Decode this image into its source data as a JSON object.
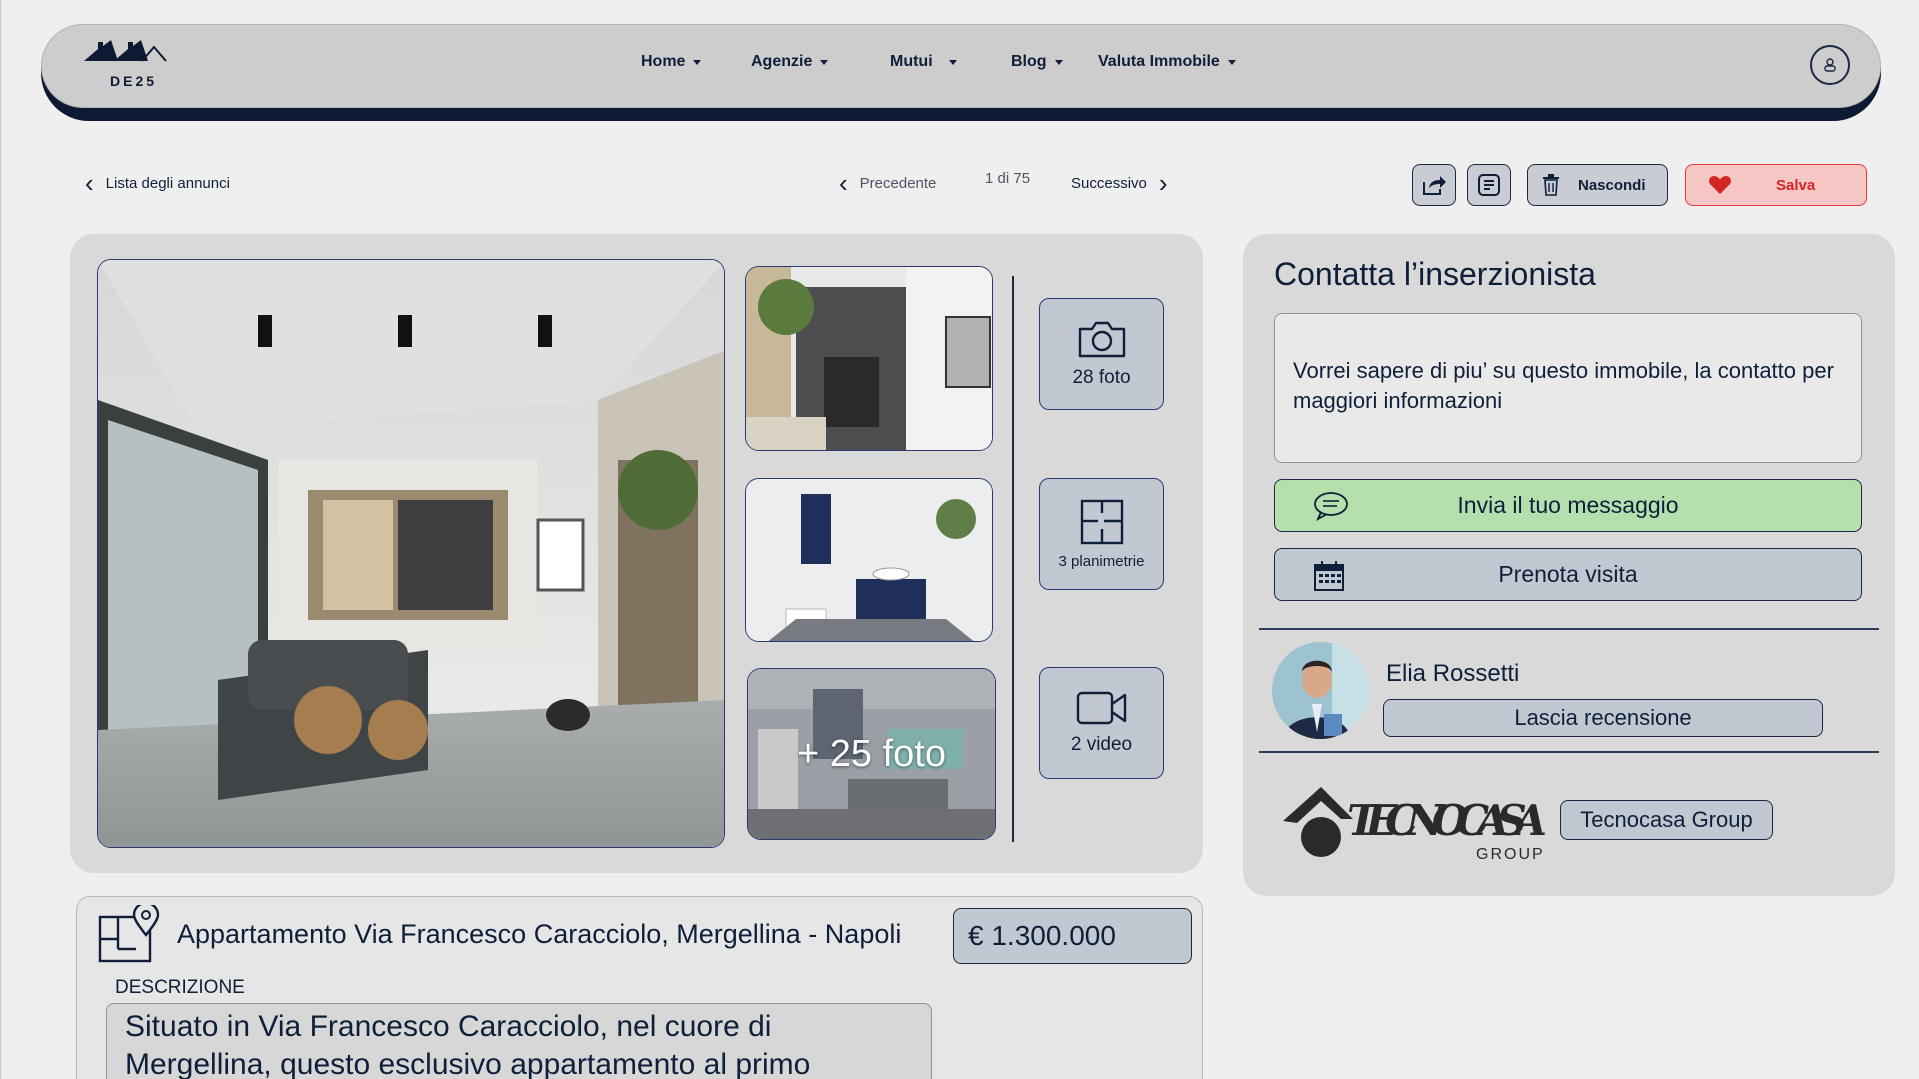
{
  "brand": {
    "name": "DE25"
  },
  "nav": {
    "items": [
      {
        "label": "Home"
      },
      {
        "label": "Agenzie"
      },
      {
        "label": "Mutui"
      },
      {
        "label": "Blog"
      },
      {
        "label": "Valuta Immobile"
      }
    ]
  },
  "subbar": {
    "back_label": "Lista degli annunci",
    "prev_label": "Precedente",
    "pagination": "1 di 75",
    "next_label": "Successivo",
    "hide_label": "Nascondi",
    "save_label": "Salva"
  },
  "gallery": {
    "more_photos": "+ 25 foto",
    "photos_label": "28 foto",
    "plans_label": "3 planimetrie",
    "video_label": "2 video"
  },
  "contact": {
    "title": "Contatta l’inserzionista",
    "message": "Vorrei sapere di piu’ su questo immobile, la contatto per maggiori informazioni",
    "send_label": "Invia il tuo messaggio",
    "visit_label": "Prenota visita",
    "agent_name": "Elia Rossetti",
    "review_label": "Lascia recensione",
    "agency_logo_text": "TECNOCASA",
    "agency_logo_sub": "GROUP",
    "agency_label": "Tecnocasa Group"
  },
  "listing": {
    "title": "Appartamento Via Francesco Caracciolo, Mergellina - Napoli",
    "price": "€ 1.300.000",
    "description_label": "DESCRIZIONE",
    "description": "Situato in Via Francesco Caracciolo, nel cuore di Mergellina, questo esclusivo appartamento al primo"
  },
  "colors": {
    "navy": "#0e1a33",
    "send_green": "#b3e0ad",
    "save_red": "#e53a3a",
    "button_gray": "#c2c8d1"
  }
}
